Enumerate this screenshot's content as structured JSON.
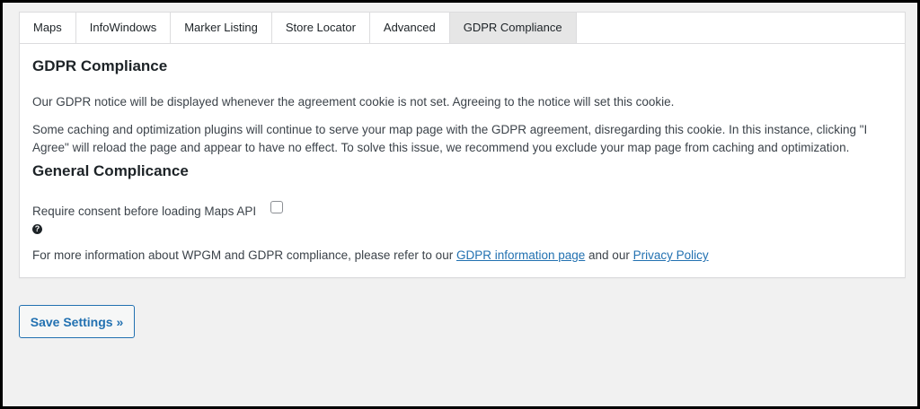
{
  "tabs": [
    {
      "label": "Maps"
    },
    {
      "label": "InfoWindows"
    },
    {
      "label": "Marker Listing"
    },
    {
      "label": "Store Locator"
    },
    {
      "label": "Advanced"
    },
    {
      "label": "GDPR Compliance"
    }
  ],
  "active_tab": "GDPR Compliance",
  "gdpr": {
    "heading": "GDPR Compliance",
    "notice_text": "Our GDPR notice will be displayed whenever the agreement cookie is not set. Agreeing to the notice will set this cookie.",
    "caching_text": "Some caching and optimization plugins will continue to serve your map page with the GDPR agreement, disregarding this cookie. In this instance, clicking \"I Agree\" will reload the page and appear to have no effect. To solve this issue, we recommend you exclude your map page from caching and optimization."
  },
  "general": {
    "heading": "General Complicance",
    "consent_label": "Require consent before loading Maps API",
    "consent_checked": false,
    "help_icon": "question-circle-icon",
    "more_info_prefix": "For more information about WPGM and GDPR compliance, please refer to our ",
    "info_link": "GDPR information page",
    "more_info_middle": " and our ",
    "privacy_link": "Privacy Policy"
  },
  "save_button": {
    "label": "Save Settings »"
  },
  "colors": {
    "link": "#2271b1",
    "page_background": "#f1f1f1",
    "active_tab": "#e6e6e6",
    "text": "#3c434a"
  }
}
